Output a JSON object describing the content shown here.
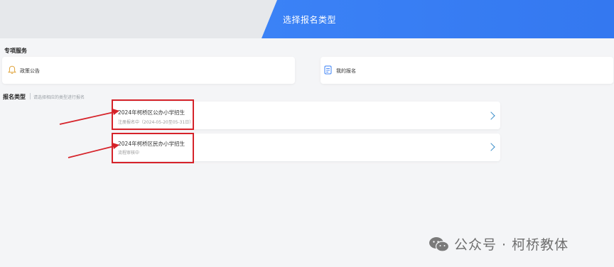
{
  "header": {
    "title": "选择报名类型"
  },
  "special_services": {
    "label": "专项服务",
    "items": [
      {
        "label": "政策公告",
        "icon": "bell-icon"
      },
      {
        "label": "我的报名",
        "icon": "document-icon"
      }
    ]
  },
  "registration": {
    "label": "报名类型",
    "hint": "请选择相应的类型进行报名",
    "items": [
      {
        "title": "2024年柯桥区公办小学招生",
        "status": "注册报名中（2024-05-20至05-31日）"
      },
      {
        "title": "2024年柯桥区民办小学招生",
        "status": "流程审核中"
      }
    ]
  },
  "watermark": {
    "text": "公众号 · 柯桥教体",
    "icon": "wechat-icon"
  },
  "colors": {
    "accent": "#3b82f6",
    "annotation": "#d6232a",
    "chevron": "#3b8ec9"
  }
}
